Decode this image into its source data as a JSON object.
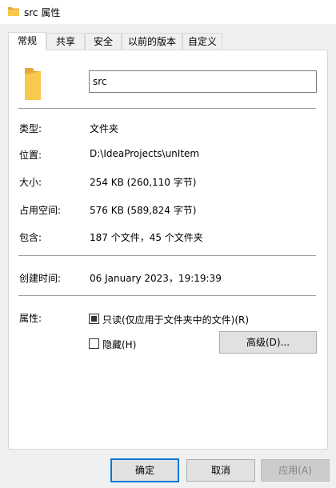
{
  "window": {
    "title": "src 属性",
    "icon": "folder-icon"
  },
  "tabs": [
    {
      "label": "常规",
      "active": true
    },
    {
      "label": "共享"
    },
    {
      "label": "安全"
    },
    {
      "label": "以前的版本"
    },
    {
      "label": "自定义"
    }
  ],
  "general": {
    "name_value": "src",
    "type_label": "类型:",
    "type_value": "文件夹",
    "location_label": "位置:",
    "location_value": "D:\\IdeaProjects\\unItem",
    "size_label": "大小:",
    "size_value": "254 KB (260,110 字节)",
    "disk_label": "占用空间:",
    "disk_value": "576 KB (589,824 字节)",
    "contains_label": "包含:",
    "contains_value": "187 个文件，45 个文件夹",
    "created_label": "创建时间:",
    "created_value": "06 January 2023，19:19:39",
    "attributes_label": "属性:",
    "readonly_label": "只读(仅应用于文件夹中的文件)(R)",
    "readonly_state": "indeterminate",
    "hidden_label": "隐藏(H)",
    "hidden_checked": false,
    "advanced_button": "高级(D)..."
  },
  "footer": {
    "ok": "确定",
    "cancel": "取消",
    "apply": "应用(A)"
  },
  "colors": {
    "accent": "#0078d7",
    "folder": "#f8c94d"
  }
}
